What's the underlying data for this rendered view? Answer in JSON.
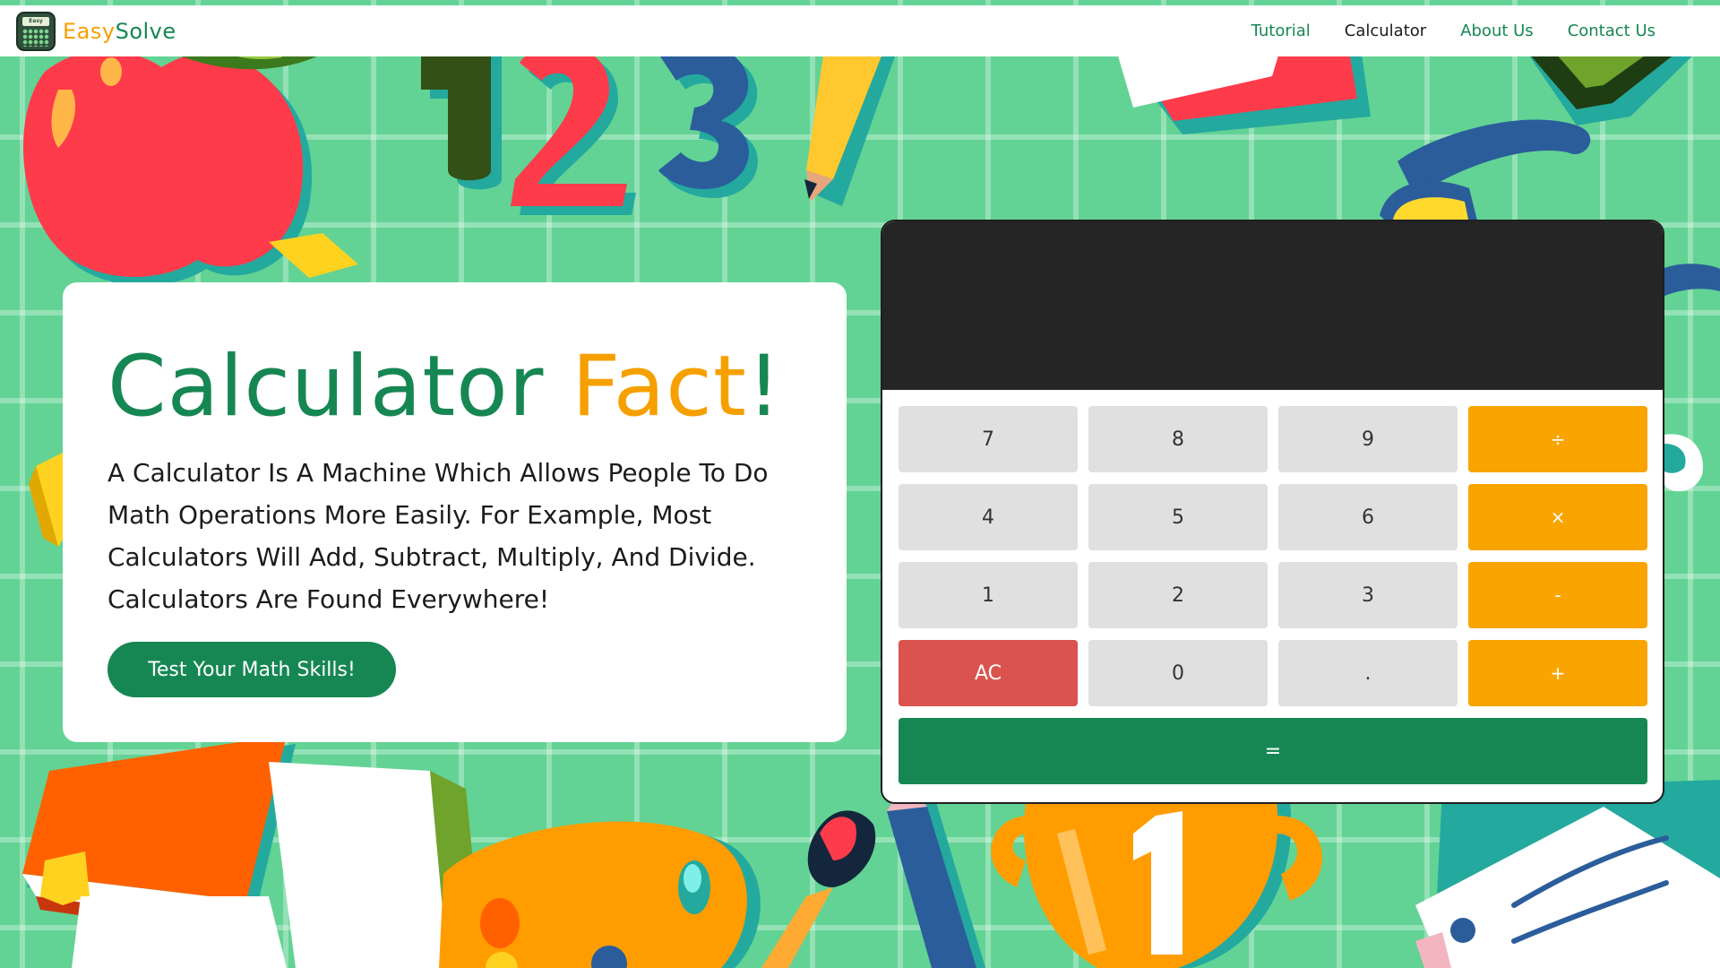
{
  "navbar": {
    "brand_easy": "Easy",
    "brand_solve": "Solve",
    "logo_text": "Easy Solve",
    "links": [
      {
        "label": "Tutorial",
        "active": false
      },
      {
        "label": "Calculator",
        "active": true
      },
      {
        "label": "About Us",
        "active": false
      },
      {
        "label": "Contact Us",
        "active": false
      }
    ]
  },
  "hero": {
    "title_part1": "Calculator",
    "title_part2": "Fact",
    "title_part3": "!",
    "description": "A Calculator Is A Machine Which Allows People To Do Math Operations More Easily. For Example, Most Calculators Will Add, Subtract, Multiply, And Divide. Calculators Are Found Everywhere!",
    "cta_label": "Test Your Math Skills!"
  },
  "calculator": {
    "display_value": "",
    "keys": [
      [
        "7",
        "8",
        "9",
        "÷"
      ],
      [
        "4",
        "5",
        "6",
        "×"
      ],
      [
        "1",
        "2",
        "3",
        "-"
      ],
      [
        "AC",
        "0",
        ".",
        "+"
      ]
    ],
    "equals_label": "="
  },
  "colors": {
    "brand_green": "#168753",
    "accent_orange": "#f6a000",
    "clear_red": "#da534f",
    "background_green": "#62d394",
    "display_dark": "#252525"
  },
  "icons": {
    "brand_logo": "calculator-logo-icon"
  }
}
